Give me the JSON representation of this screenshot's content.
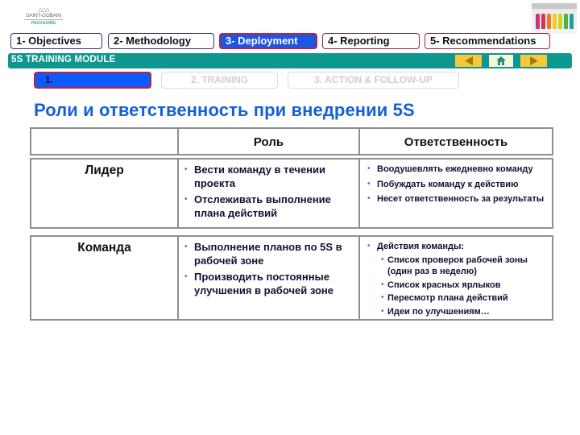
{
  "logo": {
    "brand": "SAINT-GOBAIN",
    "sub": "PACKAGING"
  },
  "bottle_colors": [
    "#d2307a",
    "#e0305a",
    "#f07a20",
    "#f6c820",
    "#c8d820",
    "#50b040",
    "#20a0a0"
  ],
  "top_tabs": [
    {
      "label": "1- Objectives",
      "state": "normal"
    },
    {
      "label": "2- Methodology",
      "state": "normal"
    },
    {
      "label": "3- Deployment",
      "state": "active"
    },
    {
      "label": "4- Reporting",
      "state": "normal"
    },
    {
      "label": "5- Recommendations",
      "state": "normal"
    }
  ],
  "module_bar": {
    "label": "5S TRAINING MODULE",
    "nav": [
      "back-icon",
      "home-icon",
      "forward-icon"
    ]
  },
  "sub_steps": [
    {
      "label": "1.",
      "state": "active"
    },
    {
      "label": "2. TRAINING",
      "state": "disabled"
    },
    {
      "label": "3. ACTION & FOLLOW-UP",
      "state": "disabled"
    }
  ],
  "page_title": "Роли и ответственность при внедрении 5S",
  "table": {
    "headers": [
      "",
      "Роль",
      "Ответственность"
    ],
    "rows": [
      {
        "name": "Лидер",
        "roles": [
          "Вести команду в течении проекта",
          "Отслеживать выполнение плана действий"
        ],
        "responsibilities": [
          "Воодушевлять ежедневно команду",
          "Побуждать команду к действию",
          "Несет ответственность за результаты"
        ]
      },
      {
        "name": "Команда",
        "roles": [
          "Выполнение планов по  5S в рабочей зоне",
          "Производить постоянные улучшения в рабочей зоне"
        ],
        "responsibilities": [
          "Действия команды:"
        ],
        "sub_responsibilities": [
          "Список проверок рабочей зоны (один раз  в неделю)",
          "Список красных ярлыков",
          "Пересмотр плана действий",
          "Идеи по улучшениям…"
        ]
      }
    ]
  },
  "colors": {
    "accent_blue": "#1a56e8",
    "title_blue": "#1560d8",
    "teal_bar": "#0e978f",
    "nav_yellow": "#f7c83a",
    "active_border": "#c0203a"
  }
}
